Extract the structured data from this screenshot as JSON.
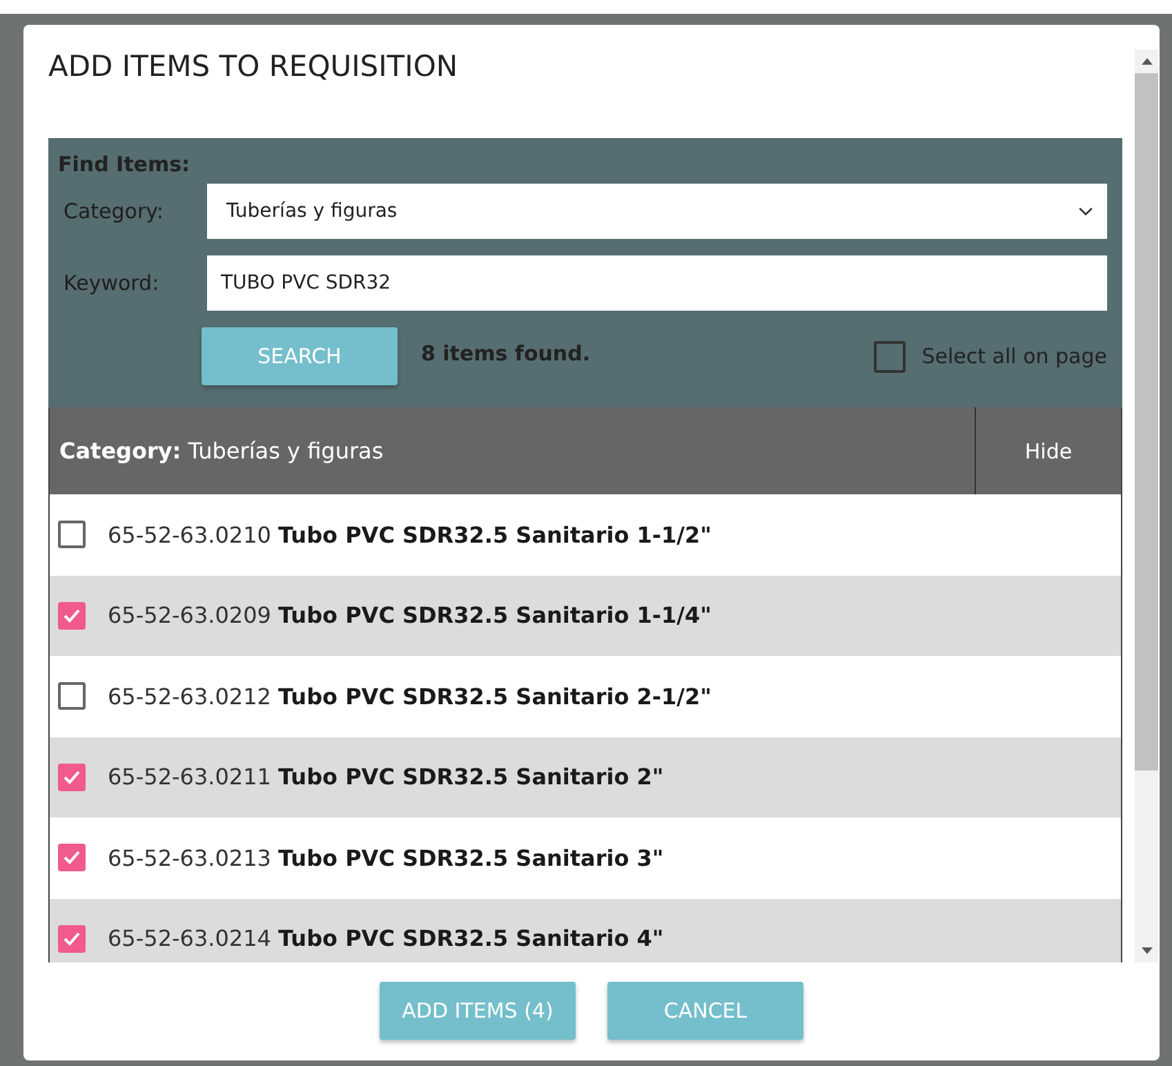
{
  "dialog": {
    "title": "ADD ITEMS TO REQUISITION",
    "find": {
      "heading": "Find Items:",
      "category_label": "Category:",
      "category_value": "Tuberías y figuras",
      "keyword_label": "Keyword:",
      "keyword_value": "TUBO PVC SDR32",
      "search_button": "SEARCH",
      "result_text": "8 items found.",
      "select_all": {
        "label": "Select all on page",
        "checked": false
      }
    },
    "results": {
      "category_label": "Category:",
      "category_value": "Tuberías y figuras",
      "hide_button": "Hide",
      "items": [
        {
          "code": "65-52-63.0210",
          "name": "Tubo PVC SDR32.5 Sanitario 1-1/2\"",
          "checked": false
        },
        {
          "code": "65-52-63.0209",
          "name": "Tubo PVC SDR32.5 Sanitario 1-1/4\"",
          "checked": true
        },
        {
          "code": "65-52-63.0212",
          "name": "Tubo PVC SDR32.5 Sanitario 2-1/2\"",
          "checked": false
        },
        {
          "code": "65-52-63.0211",
          "name": "Tubo PVC SDR32.5 Sanitario 2\"",
          "checked": true
        },
        {
          "code": "65-52-63.0213",
          "name": "Tubo PVC SDR32.5 Sanitario 3\"",
          "checked": true
        },
        {
          "code": "65-52-63.0214",
          "name": "Tubo PVC SDR32.5 Sanitario 4\"",
          "checked": true
        }
      ]
    },
    "buttons": [
      "ADD ITEMS (4)",
      "CANCEL"
    ]
  }
}
